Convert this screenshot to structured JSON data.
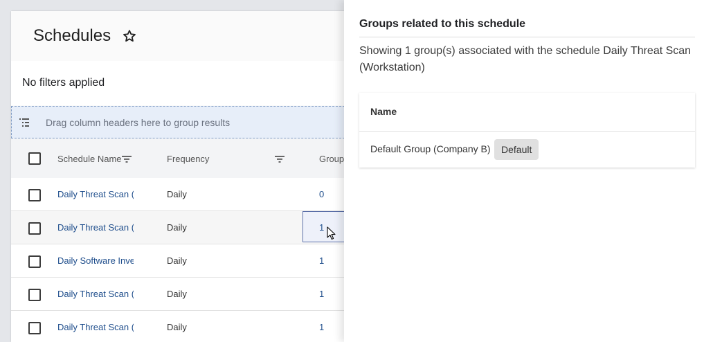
{
  "page": {
    "title": "Schedules"
  },
  "filters": {
    "text": "No filters applied"
  },
  "group_drop": {
    "text": "Drag column headers here to group results"
  },
  "table": {
    "headers": {
      "schedule_name": "Schedule Name",
      "frequency": "Frequency",
      "groups": "Group"
    },
    "rows": [
      {
        "name": "Daily Threat Scan (S",
        "frequency": "Daily",
        "groups": "0"
      },
      {
        "name": "Daily Threat Scan (W",
        "frequency": "Daily",
        "groups": "1"
      },
      {
        "name": "Daily Software Inve",
        "frequency": "Daily",
        "groups": "1"
      },
      {
        "name": "Daily Threat Scan (W",
        "frequency": "Daily",
        "groups": "1"
      },
      {
        "name": "Daily Threat Scan (W",
        "frequency": "Daily",
        "groups": "1"
      }
    ]
  },
  "panel": {
    "title": "Groups related to this schedule",
    "description": "Showing 1 group(s) associated with the schedule Daily Threat Scan (Workstation)",
    "table": {
      "header": "Name",
      "rows": [
        {
          "name": "Default Group (Company B)",
          "badge": "Default"
        }
      ]
    }
  },
  "icons": {
    "star": "star-outline-icon",
    "group": "group-rows-icon",
    "filter": "filter-icon",
    "cursor": "mouse-pointer-icon"
  },
  "colors": {
    "link": "#1f4e8c",
    "drop_zone": "#e7eef9",
    "selected_border": "#5b6fa8"
  }
}
